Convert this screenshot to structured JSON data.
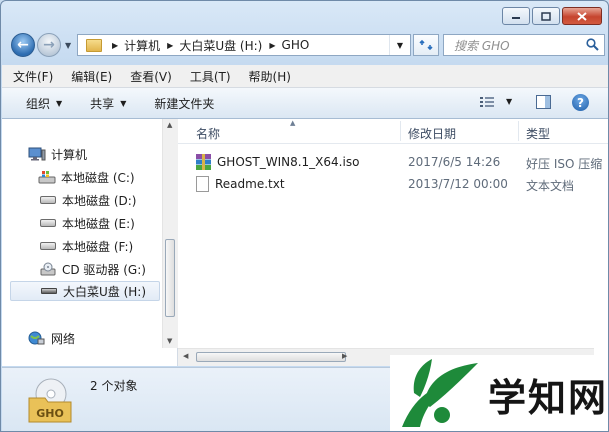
{
  "address_bar": {
    "crumbs": [
      "计算机",
      "大白菜U盘 (H:)",
      "GHO"
    ]
  },
  "search": {
    "placeholder": "搜索 GHO"
  },
  "menu": [
    "文件(F)",
    "编辑(E)",
    "查看(V)",
    "工具(T)",
    "帮助(H)"
  ],
  "toolbar": {
    "organize": "组织",
    "share": "共享",
    "new_folder": "新建文件夹"
  },
  "nav_pane": {
    "computer": "计算机",
    "drives": [
      {
        "label": "本地磁盘 (C:)",
        "icon": "os-drive-icon"
      },
      {
        "label": "本地磁盘 (D:)",
        "icon": "drive-icon"
      },
      {
        "label": "本地磁盘 (E:)",
        "icon": "drive-icon"
      },
      {
        "label": "本地磁盘 (F:)",
        "icon": "drive-icon"
      },
      {
        "label": "CD 驱动器 (G:)",
        "icon": "cd-drive-icon"
      },
      {
        "label": "大白菜U盘 (H:)",
        "icon": "usb-drive-icon",
        "selected": true
      }
    ],
    "network": "网络"
  },
  "columns": {
    "name": "名称",
    "modified": "修改日期",
    "type": "类型"
  },
  "files": [
    {
      "name": "GHOST_WIN8.1_X64.iso",
      "modified": "2017/6/5 14:26",
      "type": "好压 ISO 压缩",
      "icon": "archive-icon"
    },
    {
      "name": "Readme.txt",
      "modified": "2013/7/12 00:00",
      "type": "文本文档",
      "icon": "text-file-icon"
    }
  ],
  "details": {
    "count": "2 个对象",
    "folder_label": "GHO"
  },
  "watermark": {
    "text": "学知网"
  },
  "colors": {
    "window_frame": "#c5daf0",
    "selection": "#e2ebf6",
    "close_button": "#c6452f",
    "watermark_green": "#1e8a3a"
  }
}
